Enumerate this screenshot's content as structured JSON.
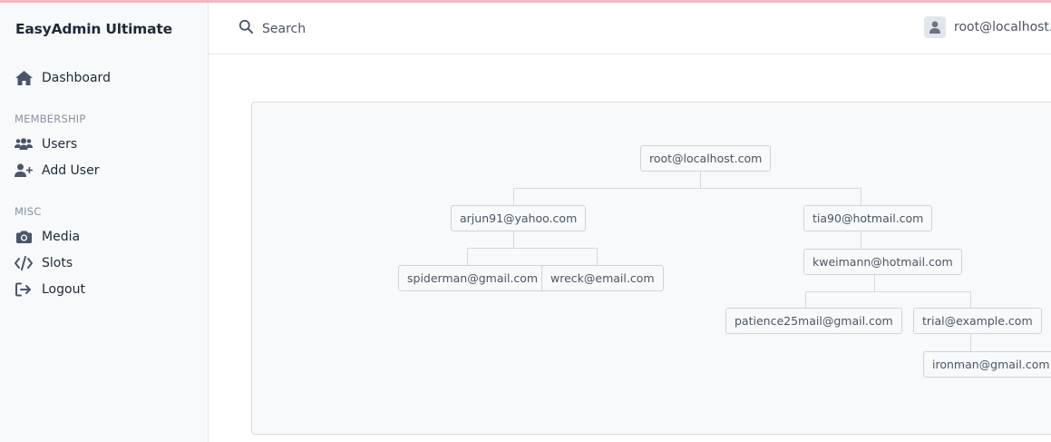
{
  "app": {
    "title": "EasyAdmin Ultimate"
  },
  "sidebar": {
    "dashboard": {
      "label": "Dashboard",
      "icon": "home-icon"
    },
    "sections": [
      {
        "label": "MEMBERSHIP",
        "items": [
          {
            "label": "Users",
            "icon": "users-icon"
          },
          {
            "label": "Add User",
            "icon": "user-plus-icon"
          }
        ]
      },
      {
        "label": "MISC",
        "items": [
          {
            "label": "Media",
            "icon": "camera-icon"
          },
          {
            "label": "Slots",
            "icon": "code-icon"
          },
          {
            "label": "Logout",
            "icon": "logout-icon"
          }
        ]
      }
    ]
  },
  "header": {
    "search_placeholder": "Search",
    "user": "root@localhost.com"
  },
  "tree": {
    "root": "root@localhost.com",
    "children": [
      {
        "email": "arjun91@yahoo.com",
        "children": [
          {
            "email": "spiderman@gmail.com"
          },
          {
            "email": "wreck@email.com"
          }
        ]
      },
      {
        "email": "tia90@hotmail.com",
        "children": [
          {
            "email": "kweimann@hotmail.com",
            "children": [
              {
                "email": "patience25mail@gmail.com"
              },
              {
                "email": "trial@example.com",
                "children": [
                  {
                    "email": "ironman@gmail.com"
                  }
                ]
              }
            ]
          }
        ]
      }
    ]
  },
  "colors": {
    "sidebar_bg": "#f8f9fb",
    "text": "#1f2937",
    "muted": "#8993a4",
    "icon": "#4a5568",
    "top_accent": "#f3b8c2"
  }
}
